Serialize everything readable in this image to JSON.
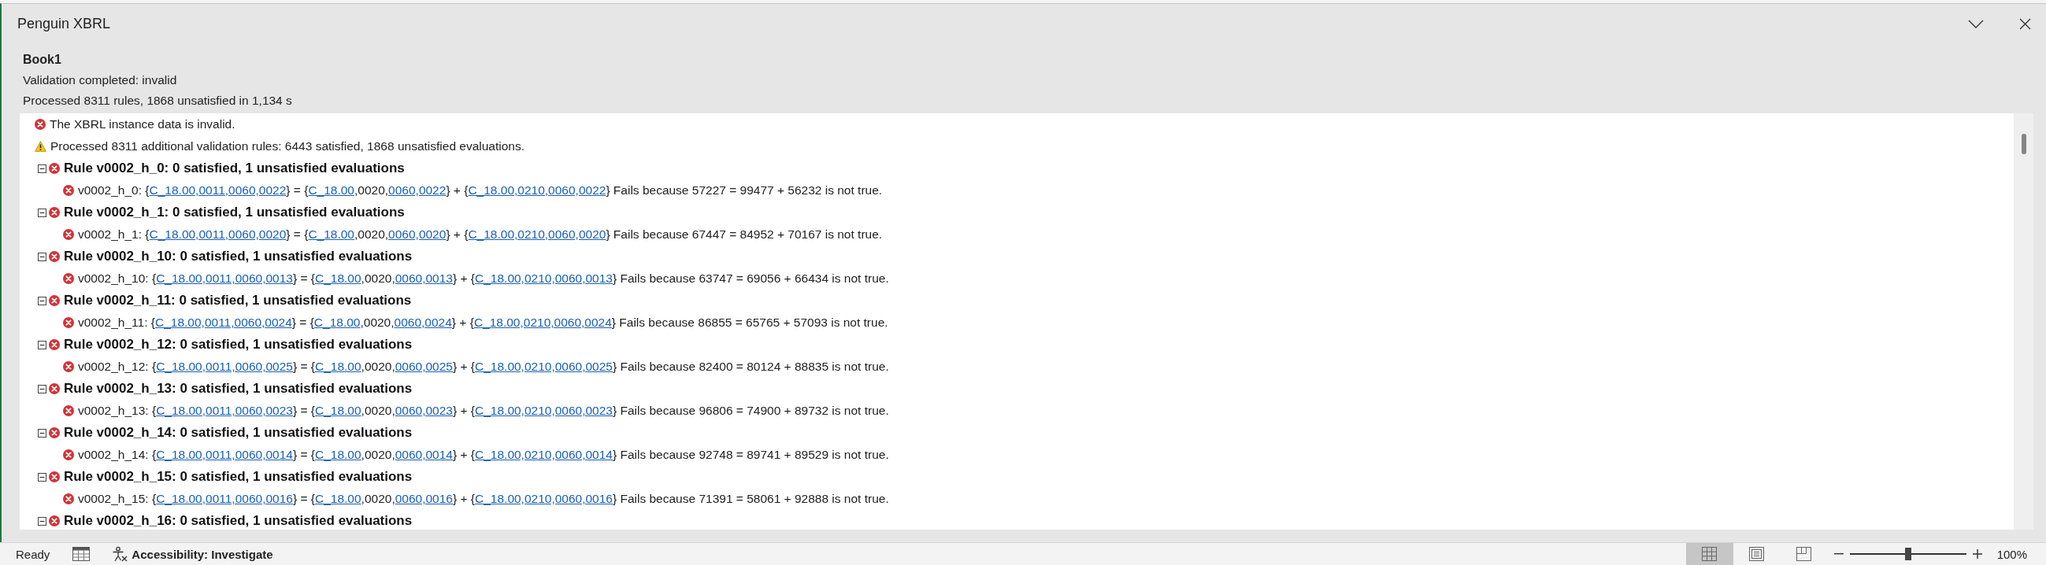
{
  "pane": {
    "title": "Penguin XBRL",
    "workbook": "Book1",
    "status": "Validation completed: invalid",
    "summary": "Processed 8311 rules, 1868 unsatisfied in 1,134 s"
  },
  "messages": [
    {
      "kind": "error",
      "text": "The XBRL instance data is invalid."
    },
    {
      "kind": "warning",
      "text": "Processed 8311 additional validation rules: 6443 satisfied, 1868 unsatisfied evaluations."
    }
  ],
  "rules": [
    {
      "title": "Rule v0002_h_0: 0 satisfied, 1 unsatisfied evaluations",
      "expanded": true,
      "evaluations": [
        {
          "segments": [
            {
              "kind": "text",
              "text": "v0002_h_0: {"
            },
            {
              "kind": "link",
              "text": "C_18.00,0011,0060,0022"
            },
            {
              "kind": "text",
              "text": "} = {"
            },
            {
              "kind": "link",
              "text": "C_18.00"
            },
            {
              "kind": "text",
              "text": ",0020,"
            },
            {
              "kind": "link",
              "text": "0060,0022"
            },
            {
              "kind": "text",
              "text": "} + {"
            },
            {
              "kind": "link",
              "text": "C_18.00,0210,0060,0022"
            },
            {
              "kind": "text",
              "text": "} Fails because 57227 = 99477 + 56232 is not true."
            }
          ]
        }
      ]
    },
    {
      "title": "Rule v0002_h_1: 0 satisfied, 1 unsatisfied evaluations",
      "expanded": true,
      "evaluations": [
        {
          "segments": [
            {
              "kind": "text",
              "text": "v0002_h_1: {"
            },
            {
              "kind": "link",
              "text": "C_18.00,0011,0060,0020"
            },
            {
              "kind": "text",
              "text": "} = {"
            },
            {
              "kind": "link",
              "text": "C_18.00"
            },
            {
              "kind": "text",
              "text": ",0020,"
            },
            {
              "kind": "link",
              "text": "0060,0020"
            },
            {
              "kind": "text",
              "text": "} + {"
            },
            {
              "kind": "link",
              "text": "C_18.00,0210,0060,0020"
            },
            {
              "kind": "text",
              "text": "} Fails because 67447 = 84952 + 70167 is not true."
            }
          ]
        }
      ]
    },
    {
      "title": "Rule v0002_h_10: 0 satisfied, 1 unsatisfied evaluations",
      "expanded": true,
      "evaluations": [
        {
          "segments": [
            {
              "kind": "text",
              "text": "v0002_h_10: {"
            },
            {
              "kind": "link",
              "text": "C_18.00,0011,0060,0013"
            },
            {
              "kind": "text",
              "text": "} = {"
            },
            {
              "kind": "link",
              "text": "C_18.00"
            },
            {
              "kind": "text",
              "text": ",0020,"
            },
            {
              "kind": "link",
              "text": "0060,0013"
            },
            {
              "kind": "text",
              "text": "} + {"
            },
            {
              "kind": "link",
              "text": "C_18.00,0210,0060,0013"
            },
            {
              "kind": "text",
              "text": "} Fails because 63747 = 69056 + 66434 is not true."
            }
          ]
        }
      ]
    },
    {
      "title": "Rule v0002_h_11: 0 satisfied, 1 unsatisfied evaluations",
      "expanded": true,
      "evaluations": [
        {
          "segments": [
            {
              "kind": "text",
              "text": "v0002_h_11: {"
            },
            {
              "kind": "link",
              "text": "C_18.00,0011,0060,0024"
            },
            {
              "kind": "text",
              "text": "} = {"
            },
            {
              "kind": "link",
              "text": "C_18.00"
            },
            {
              "kind": "text",
              "text": ",0020,"
            },
            {
              "kind": "link",
              "text": "0060,0024"
            },
            {
              "kind": "text",
              "text": "} + {"
            },
            {
              "kind": "link",
              "text": "C_18.00,0210,0060,0024"
            },
            {
              "kind": "text",
              "text": "} Fails because 86855 = 65765 + 57093 is not true."
            }
          ]
        }
      ]
    },
    {
      "title": "Rule v0002_h_12: 0 satisfied, 1 unsatisfied evaluations",
      "expanded": true,
      "evaluations": [
        {
          "segments": [
            {
              "kind": "text",
              "text": "v0002_h_12: {"
            },
            {
              "kind": "link",
              "text": "C_18.00,0011,0060,0025"
            },
            {
              "kind": "text",
              "text": "} = {"
            },
            {
              "kind": "link",
              "text": "C_18.00"
            },
            {
              "kind": "text",
              "text": ",0020,"
            },
            {
              "kind": "link",
              "text": "0060,0025"
            },
            {
              "kind": "text",
              "text": "} + {"
            },
            {
              "kind": "link",
              "text": "C_18.00,0210,0060,0025"
            },
            {
              "kind": "text",
              "text": "} Fails because 82400 = 80124 + 88835 is not true."
            }
          ]
        }
      ]
    },
    {
      "title": "Rule v0002_h_13: 0 satisfied, 1 unsatisfied evaluations",
      "expanded": true,
      "evaluations": [
        {
          "segments": [
            {
              "kind": "text",
              "text": "v0002_h_13: {"
            },
            {
              "kind": "link",
              "text": "C_18.00,0011,0060,0023"
            },
            {
              "kind": "text",
              "text": "} = {"
            },
            {
              "kind": "link",
              "text": "C_18.00"
            },
            {
              "kind": "text",
              "text": ",0020,"
            },
            {
              "kind": "link",
              "text": "0060,0023"
            },
            {
              "kind": "text",
              "text": "} + {"
            },
            {
              "kind": "link",
              "text": "C_18.00,0210,0060,0023"
            },
            {
              "kind": "text",
              "text": "} Fails because 96806 = 74900 + 89732 is not true."
            }
          ]
        }
      ]
    },
    {
      "title": "Rule v0002_h_14: 0 satisfied, 1 unsatisfied evaluations",
      "expanded": true,
      "evaluations": [
        {
          "segments": [
            {
              "kind": "text",
              "text": "v0002_h_14: {"
            },
            {
              "kind": "link",
              "text": "C_18.00,0011,0060,0014"
            },
            {
              "kind": "text",
              "text": "} = {"
            },
            {
              "kind": "link",
              "text": "C_18.00"
            },
            {
              "kind": "text",
              "text": ",0020,"
            },
            {
              "kind": "link",
              "text": "0060,0014"
            },
            {
              "kind": "text",
              "text": "} + {"
            },
            {
              "kind": "link",
              "text": "C_18.00,0210,0060,0014"
            },
            {
              "kind": "text",
              "text": "} Fails because 92748 = 89741 + 89529 is not true."
            }
          ]
        }
      ]
    },
    {
      "title": "Rule v0002_h_15: 0 satisfied, 1 unsatisfied evaluations",
      "expanded": true,
      "evaluations": [
        {
          "segments": [
            {
              "kind": "text",
              "text": "v0002_h_15: {"
            },
            {
              "kind": "link",
              "text": "C_18.00,0011,0060,0016"
            },
            {
              "kind": "text",
              "text": "} = {"
            },
            {
              "kind": "link",
              "text": "C_18.00"
            },
            {
              "kind": "text",
              "text": ",0020,"
            },
            {
              "kind": "link",
              "text": "0060,0016"
            },
            {
              "kind": "text",
              "text": "} + {"
            },
            {
              "kind": "link",
              "text": "C_18.00,0210,0060,0016"
            },
            {
              "kind": "text",
              "text": "} Fails because 71391 = 58061 + 92888 is not true."
            }
          ]
        }
      ]
    },
    {
      "title": "Rule v0002_h_16: 0 satisfied, 1 unsatisfied evaluations",
      "expanded": true
    }
  ],
  "status_bar": {
    "mode": "Ready",
    "accessibility": "Accessibility: Investigate",
    "views": [
      {
        "kind": "normal",
        "selected": true
      },
      {
        "kind": "page_layout",
        "selected": false
      },
      {
        "kind": "page_break",
        "selected": false
      }
    ],
    "zoom": {
      "level": 0.5,
      "reading": "100%"
    }
  }
}
